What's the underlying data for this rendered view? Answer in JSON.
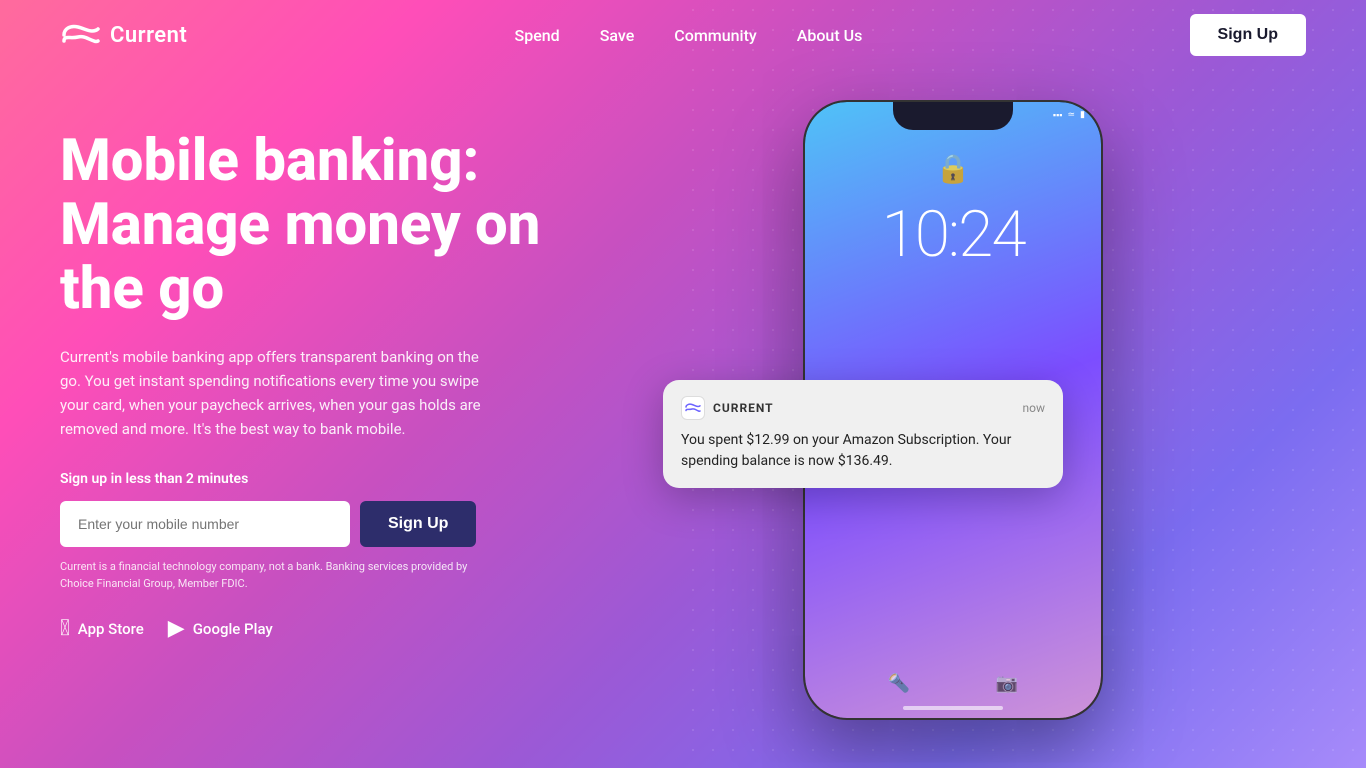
{
  "nav": {
    "logo_text": "Current",
    "links": [
      {
        "label": "Spend",
        "href": "#"
      },
      {
        "label": "Save",
        "href": "#"
      },
      {
        "label": "Community",
        "href": "#"
      },
      {
        "label": "About Us",
        "href": "#"
      }
    ],
    "signup_label": "Sign Up"
  },
  "hero": {
    "title": "Mobile banking: Manage money on the go",
    "description": "Current's mobile banking app offers transparent banking on the go. You get instant spending notifications every time you swipe your card, when your paycheck arrives, when your gas holds are removed and more. It's the best way to bank mobile.",
    "signup_prompt": "Sign up in less than 2 minutes",
    "phone_placeholder": "Enter your mobile number",
    "signup_button": "Sign Up",
    "disclaimer": "Current is a financial technology company, not a bank. Banking services provided by Choice Financial Group, Member FDIC.",
    "app_store_label": "App Store",
    "google_play_label": "Google Play"
  },
  "phone": {
    "time": "10:24",
    "status_bar": "▪ ▪ ▪"
  },
  "notification": {
    "app_name": "CURRENT",
    "time": "now",
    "body": "You spent $12.99 on your Amazon Subscription. Your spending balance is now $136.49."
  }
}
